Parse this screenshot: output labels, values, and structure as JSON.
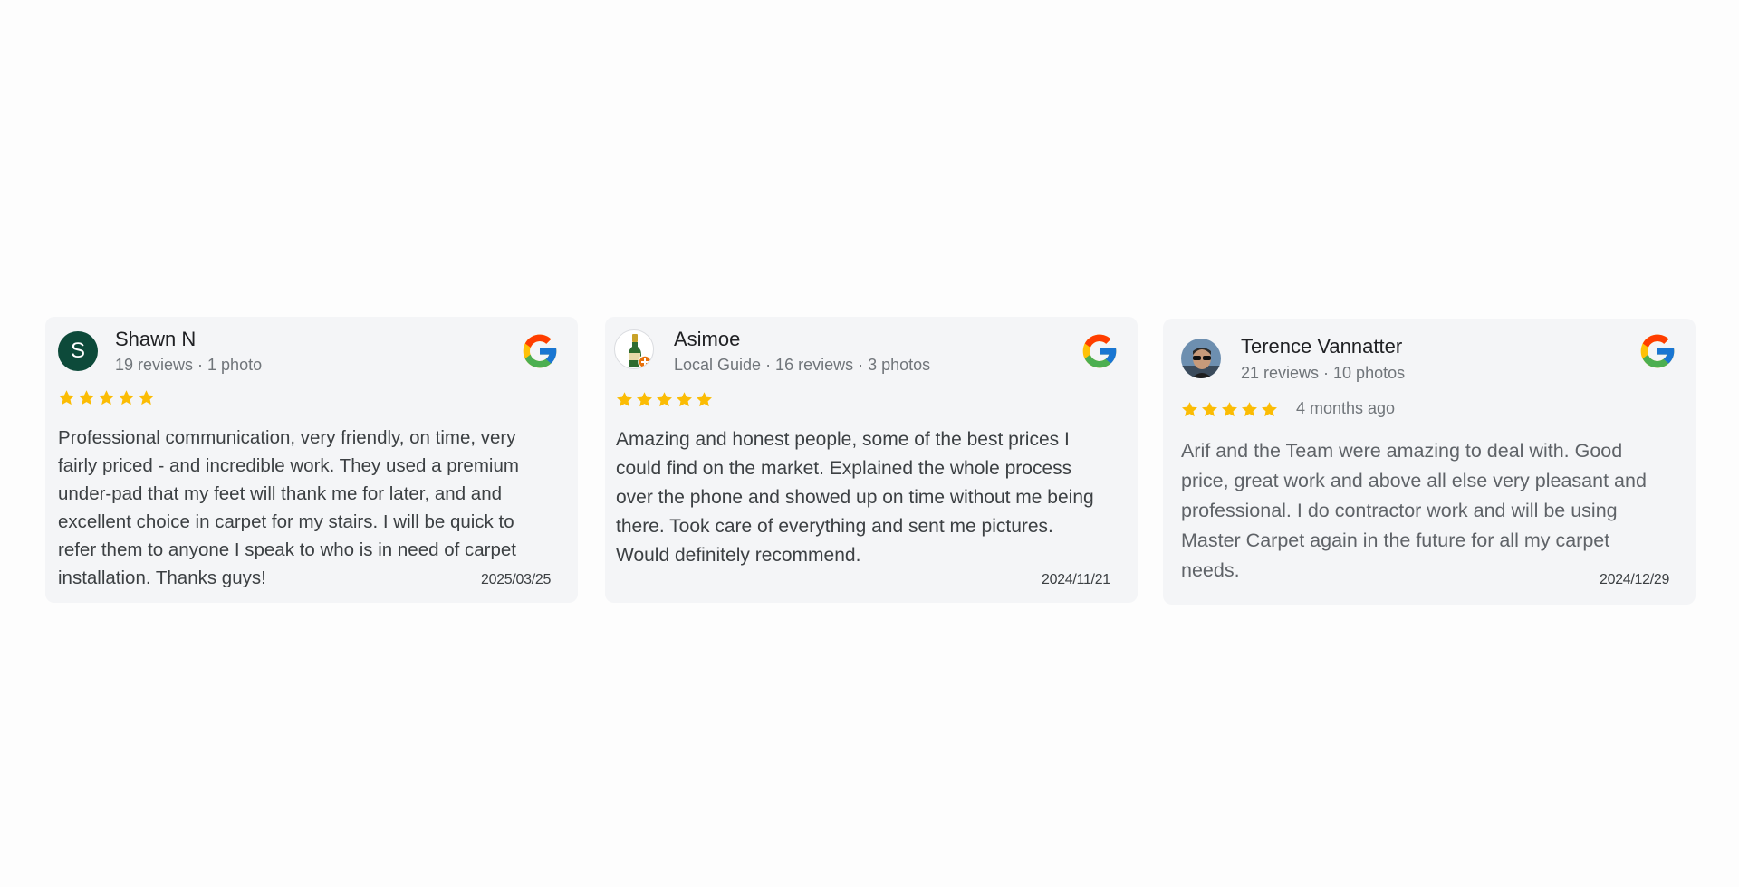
{
  "reviews": [
    {
      "reviewer_name": "Shawn N",
      "avatar_initial": "S",
      "avatar_color": "#0d4a3a",
      "meta": "19 reviews · 1 photo",
      "rating": 5,
      "rating_max": 5,
      "text": "Professional communication, very friendly, on time, very fairly priced - and incredible work. They used a premium under-pad that my feet will thank me for later, and and excellent choice in carpet for my stairs. I will be quick to refer them to anyone I speak to who is in need of carpet installation. Thanks guys!",
      "date": "2025/03/25",
      "source_icon": "google-icon"
    },
    {
      "reviewer_name": "Asimoe",
      "avatar_icon": "champagne-bottle-avatar",
      "meta": "Local Guide · 16 reviews · 3 photos",
      "rating": 5,
      "rating_max": 5,
      "text": "Amazing and honest people, some of the best prices I could find on the market. Explained the whole process over the phone and showed up on time without me being there. Took care of everything and sent me pictures. Would definitely recommend.",
      "date": "2024/11/21",
      "source_icon": "google-icon"
    },
    {
      "reviewer_name": "Terence Vannatter",
      "avatar_icon": "profile-photo-avatar",
      "meta": "21 reviews · 10 photos",
      "rating": 5,
      "rating_max": 5,
      "time_ago": "4 months ago",
      "text": "Arif and the Team were amazing to deal with. Good price, great work and above all else very pleasant and professional. I do contractor work and will be using Master Carpet again in the future for all my carpet needs.",
      "date": "2024/12/29",
      "source_icon": "google-icon"
    }
  ],
  "colors": {
    "star": "#fbbc04",
    "card_background": "#f4f5f7",
    "page_background": "#fdfdfd",
    "google_blue": "#4285f4",
    "google_red": "#ea4335",
    "google_yellow": "#fbbc05",
    "google_green": "#34a853"
  }
}
